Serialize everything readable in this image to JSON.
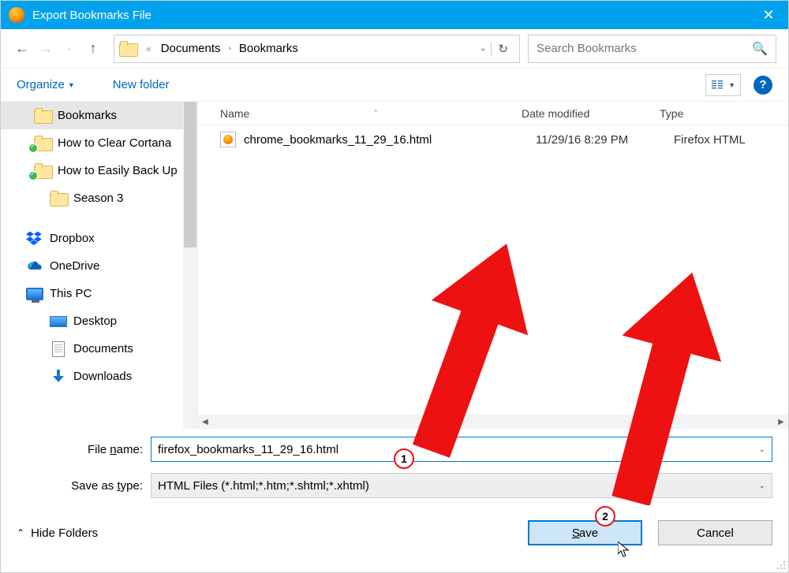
{
  "title": "Export Bookmarks File",
  "breadcrumb": {
    "root_double_arrow": "«",
    "part1": "Documents",
    "sep": "›",
    "part2": "Bookmarks"
  },
  "search": {
    "placeholder": "Search Bookmarks"
  },
  "cmdbar": {
    "organize": "Organize",
    "newfolder": "New folder"
  },
  "columns": {
    "name": "Name",
    "date": "Date modified",
    "type": "Type"
  },
  "tree": {
    "items": [
      {
        "label": "Bookmarks",
        "icon": "folder",
        "selected": true
      },
      {
        "label": "How to Clear Cortana",
        "icon": "folder",
        "badge": true
      },
      {
        "label": "How to Easily Back Up",
        "icon": "folder",
        "badge": true
      },
      {
        "label": "Season 3",
        "icon": "folder",
        "indent": true
      },
      {
        "label": "Dropbox",
        "icon": "dropbox",
        "service": true
      },
      {
        "label": "OneDrive",
        "icon": "onedrive",
        "service": true
      },
      {
        "label": "This PC",
        "icon": "pc",
        "service": true
      },
      {
        "label": "Desktop",
        "icon": "drive",
        "indent": true
      },
      {
        "label": "Documents",
        "icon": "doc",
        "indent": true
      },
      {
        "label": "Downloads",
        "icon": "download",
        "indent": true
      }
    ]
  },
  "files": [
    {
      "name": "chrome_bookmarks_11_29_16.html",
      "date": "11/29/16 8:29 PM",
      "type": "Firefox HTML"
    }
  ],
  "filename_label": "File name:",
  "filename_value": "firefox_bookmarks_11_29_16.html",
  "savetype_label": "Save as type:",
  "savetype_value": "HTML Files (*.html;*.htm;*.shtml;*.xhtml)",
  "hide_folders": "Hide Folders",
  "save_btn": "Save",
  "cancel_btn": "Cancel",
  "annotations": {
    "circle1": "1",
    "circle2": "2"
  }
}
